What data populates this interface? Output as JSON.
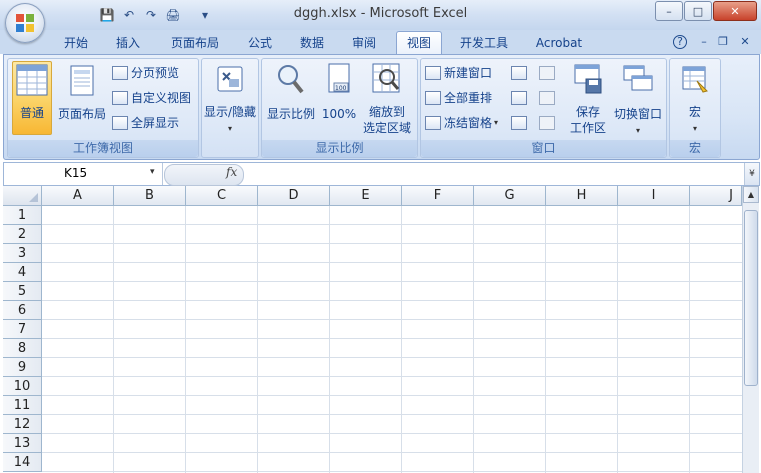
{
  "window": {
    "title": "dggh.xlsx - Microsoft Excel",
    "minimize": "–",
    "maximize": "□",
    "close": "✕"
  },
  "quick_access": {
    "save": "💾",
    "undo": "↶",
    "redo": "↷",
    "print_preview": "🖨",
    "customize": "▾"
  },
  "tabs": [
    "开始",
    "插入",
    "页面布局",
    "公式",
    "数据",
    "审阅",
    "视图",
    "开发工具",
    "Acrobat"
  ],
  "active_tab": "视图",
  "ribbon_icons": {
    "help": "?",
    "minimize": "–",
    "restore": "❐",
    "close": "✕"
  },
  "ribbon": {
    "workbook_views": {
      "label": "工作簿视图",
      "normal": "普通",
      "page_layout": "页面布局",
      "page_break_preview": "分页预览",
      "custom_views": "自定义视图",
      "full_screen": "全屏显示"
    },
    "show_hide": {
      "label": "显示/隐藏",
      "dropdown": "▾"
    },
    "zoom": {
      "label": "显示比例",
      "zoom": "显示比例",
      "hundred": "100%",
      "zoom_to_selection_line1": "缩放到",
      "zoom_to_selection_line2": "选定区域"
    },
    "window": {
      "label": "窗口",
      "new_window": "新建窗口",
      "arrange_all": "全部重排",
      "freeze_panes": "冻结窗格",
      "save_workspace_line1": "保存",
      "save_workspace_line2": "工作区",
      "switch_windows": "切换窗口",
      "dropdown": "▾"
    },
    "macros": {
      "label": "宏",
      "macros": "宏",
      "dropdown": "▾"
    }
  },
  "formula_bar": {
    "name_box": "K15",
    "fx": "fx",
    "formula": "",
    "dropdown": "▾",
    "expand": "¥"
  },
  "grid": {
    "columns": [
      "A",
      "B",
      "C",
      "D",
      "E",
      "F",
      "G",
      "H",
      "I",
      "J"
    ],
    "rows": [
      "1",
      "2",
      "3",
      "4",
      "5",
      "6",
      "7",
      "8",
      "9",
      "10",
      "11",
      "12",
      "13",
      "14"
    ]
  },
  "scrollbar": {
    "up": "▲"
  }
}
